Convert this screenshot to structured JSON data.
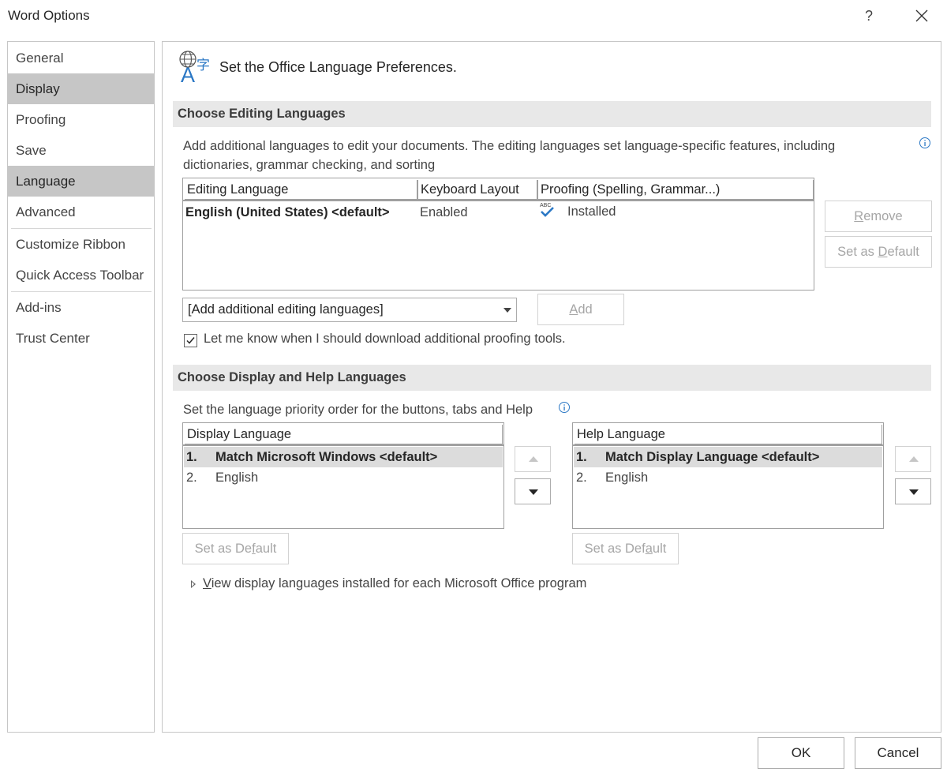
{
  "window": {
    "title": "Word Options",
    "help_label": "?"
  },
  "nav": {
    "items": [
      {
        "label": "General"
      },
      {
        "label": "Display"
      },
      {
        "label": "Proofing"
      },
      {
        "label": "Save"
      },
      {
        "label": "Language"
      },
      {
        "label": "Advanced"
      },
      {
        "label": "Customize Ribbon"
      },
      {
        "label": "Quick Access Toolbar"
      },
      {
        "label": "Add-ins"
      },
      {
        "label": "Trust Center"
      }
    ],
    "selected": "Language"
  },
  "header": {
    "icon": "language-icon",
    "icon_glyphs": [
      "A",
      "字"
    ],
    "text": "Set the Office Language Preferences."
  },
  "editing": {
    "section_title": "Choose Editing Languages",
    "description": "Add additional languages to edit your documents. The editing languages set language-specific features, including dictionaries, grammar checking, and sorting",
    "columns": [
      "Editing Language",
      "Keyboard Layout",
      "Proofing (Spelling, Grammar...)"
    ],
    "rows": [
      {
        "language": "English (United States) <default>",
        "keyboard": "Enabled",
        "proofing": "Installed",
        "proofing_icon_text": "ABC"
      }
    ],
    "remove_button": {
      "pre": "",
      "key": "R",
      "post": "emove"
    },
    "set_default_button": {
      "pre": "Set as ",
      "key": "D",
      "post": "efault"
    },
    "dropdown_value": "[Add additional editing languages]",
    "add_button": {
      "pre": "",
      "key": "A",
      "post": "dd"
    },
    "checkbox_label": "Let me know when I should download additional proofing tools.",
    "checkbox_checked": true
  },
  "display_help": {
    "section_title": "Choose Display and Help Languages",
    "description": "Set the language priority order for the buttons, tabs and Help",
    "display_list": {
      "header": "Display Language",
      "items": [
        {
          "num": "1.",
          "text": "Match Microsoft Windows <default>"
        },
        {
          "num": "2.",
          "text": "English"
        }
      ],
      "set_default_button": {
        "pre": "Set as De",
        "key": "f",
        "post": "ault"
      }
    },
    "help_list": {
      "header": "Help Language",
      "items": [
        {
          "num": "1.",
          "text": "Match Display Language <default>"
        },
        {
          "num": "2.",
          "text": "English"
        }
      ],
      "set_default_button": {
        "pre": "Set as Def",
        "key": "a",
        "post": "ult"
      }
    },
    "expander": {
      "key": "V",
      "rest": "iew display languages installed for each Microsoft Office program"
    }
  },
  "footer": {
    "ok_label": "OK",
    "cancel_label": "Cancel"
  },
  "colors": {
    "selection_gray": "#c6c6c6",
    "section_bar": "#e8e8e8",
    "accent_blue": "#2b78c5"
  }
}
